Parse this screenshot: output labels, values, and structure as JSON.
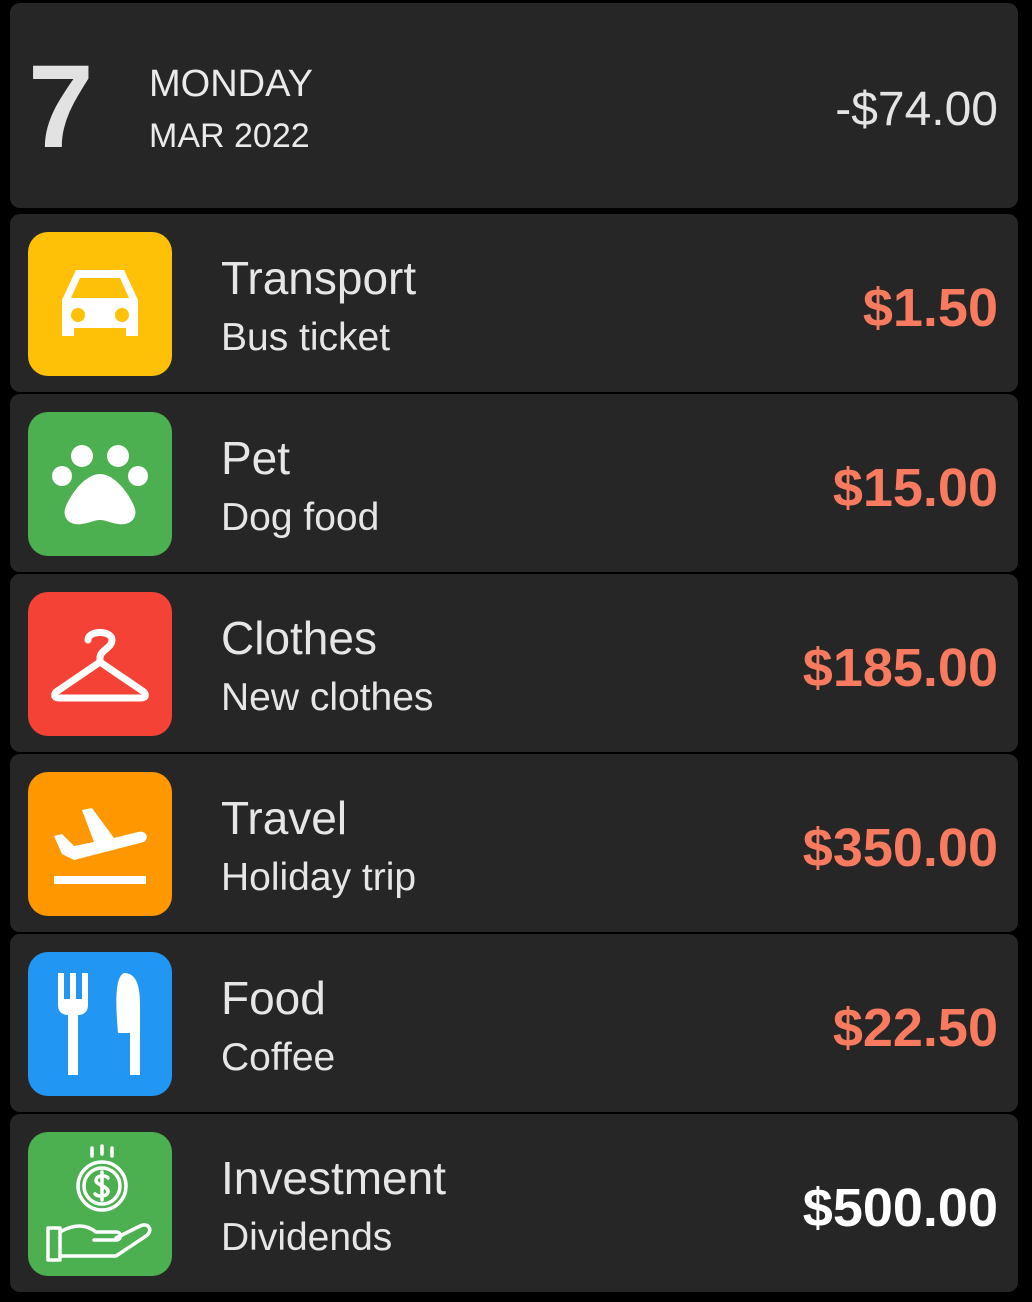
{
  "day": {
    "number": "7",
    "weekday": "MONDAY",
    "month_year": "MAR 2022",
    "total": "-$74.00"
  },
  "colors": {
    "expense": "#f87a5f",
    "income": "#ffffff",
    "transport": "#ffc107",
    "pet": "#4caf50",
    "clothes": "#f44336",
    "travel": "#ff9800",
    "food": "#2196f3",
    "investment": "#4caf50"
  },
  "transactions": [
    {
      "category": "Transport",
      "note": "Bus ticket",
      "amount": "$1.50",
      "icon": "car-icon",
      "kind": "expense"
    },
    {
      "category": "Pet",
      "note": "Dog food",
      "amount": "$15.00",
      "icon": "paw-icon",
      "kind": "expense"
    },
    {
      "category": "Clothes",
      "note": "New clothes",
      "amount": "$185.00",
      "icon": "hanger-icon",
      "kind": "expense"
    },
    {
      "category": "Travel",
      "note": "Holiday trip",
      "amount": "$350.00",
      "icon": "plane-departure-icon",
      "kind": "expense"
    },
    {
      "category": "Food",
      "note": "Coffee",
      "amount": "$22.50",
      "icon": "fork-knife-icon",
      "kind": "expense"
    },
    {
      "category": "Investment",
      "note": "Dividends",
      "amount": "$500.00",
      "icon": "coin-hand-icon",
      "kind": "income"
    }
  ]
}
